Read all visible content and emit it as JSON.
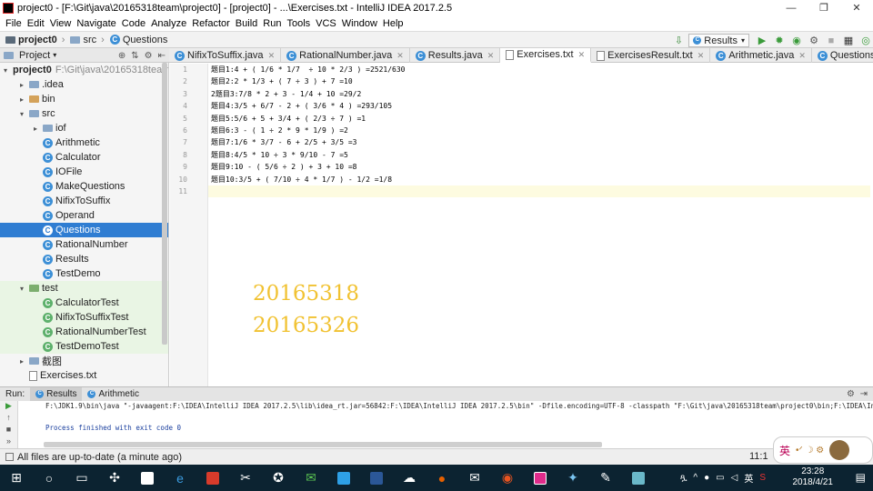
{
  "window": {
    "title": "project0 - [F:\\Git\\java\\20165318team\\project0] - [project0] - ...\\Exercises.txt - IntelliJ IDEA 2017.2.5",
    "controls": [
      "—",
      "❐",
      "✕"
    ]
  },
  "menu": [
    "File",
    "Edit",
    "View",
    "Navigate",
    "Code",
    "Analyze",
    "Refactor",
    "Build",
    "Run",
    "Tools",
    "VCS",
    "Window",
    "Help"
  ],
  "breadcrumb": [
    "project0",
    "src",
    "Questions"
  ],
  "toolbar": {
    "run_config": "Results"
  },
  "project_panel": {
    "title": "Project"
  },
  "tabs": [
    {
      "label": "NifixToSuffix.java",
      "kind": "class"
    },
    {
      "label": "RationalNumber.java",
      "kind": "class"
    },
    {
      "label": "Results.java",
      "kind": "class"
    },
    {
      "label": "Exercises.txt",
      "kind": "text",
      "active": true
    },
    {
      "label": "ExercisesResult.txt",
      "kind": "text"
    },
    {
      "label": "Arithmetic.java",
      "kind": "class"
    },
    {
      "label": "Questions.java",
      "kind": "class"
    }
  ],
  "tree": [
    {
      "label": "project0",
      "path": "F:\\Git\\java\\20165318team",
      "depth": 0,
      "arrow": "▾",
      "icon": "folder-dark",
      "bold": true
    },
    {
      "label": ".idea",
      "depth": 1,
      "arrow": "▸",
      "icon": "folder"
    },
    {
      "label": "bin",
      "depth": 1,
      "arrow": "▸",
      "icon": "folder-orange"
    },
    {
      "label": "src",
      "depth": 1,
      "arrow": "▾",
      "icon": "folder"
    },
    {
      "label": "iof",
      "depth": 2,
      "arrow": "▸",
      "icon": "folder"
    },
    {
      "label": "Arithmetic",
      "depth": 2,
      "icon": "class"
    },
    {
      "label": "Calculator",
      "depth": 2,
      "icon": "class"
    },
    {
      "label": "IOFile",
      "depth": 2,
      "icon": "class"
    },
    {
      "label": "MakeQuestions",
      "depth": 2,
      "icon": "class"
    },
    {
      "label": "NifixToSuffix",
      "depth": 2,
      "icon": "class"
    },
    {
      "label": "Operand",
      "depth": 2,
      "icon": "class"
    },
    {
      "label": "Questions",
      "depth": 2,
      "icon": "class",
      "selected": true
    },
    {
      "label": "RationalNumber",
      "depth": 2,
      "icon": "class"
    },
    {
      "label": "Results",
      "depth": 2,
      "icon": "class"
    },
    {
      "label": "TestDemo",
      "depth": 2,
      "icon": "class"
    },
    {
      "label": "test",
      "depth": 1,
      "arrow": "▾",
      "icon": "folder-green",
      "test": true
    },
    {
      "label": "CalculatorTest",
      "depth": 2,
      "icon": "class-green",
      "test": true
    },
    {
      "label": "NifixToSuffixTest",
      "depth": 2,
      "icon": "class-green",
      "test": true
    },
    {
      "label": "RationalNumberTest",
      "depth": 2,
      "icon": "class-green",
      "test": true
    },
    {
      "label": "TestDemoTest",
      "depth": 2,
      "icon": "class-green",
      "test": true
    },
    {
      "label": "截图",
      "depth": 1,
      "arrow": "▸",
      "icon": "folder"
    },
    {
      "label": "Exercises.txt",
      "depth": 1,
      "icon": "text"
    }
  ],
  "editor": {
    "lines": [
      "题目1:4 + ( 1/6 * 1/7  ÷ 10 * 2/3 ) =2521/630",
      "题目2:2 * 1/3 + ( 7 ÷ 3 ) + 7 =10",
      "2题目3:7/8 * 2 + 3 - 1/4 + 10 =29/2",
      "题目4:3/5 + 6/7 - 2 + ( 3/6 * 4 ) =293/105",
      "题目5:5/6 + 5 + 3/4 + ( 2/3 ÷ 7 ) =1",
      "题目6:3 - ( 1 ÷ 2 * 9 * 1/9 ) =2",
      "题目7:1/6 * 3/7 - 6 + 2/5 + 3/5 =3",
      "题目8:4/5 * 10 ÷ 3 * 9/10 - 7 =5",
      "题目9:10 - ( 5/6 ÷ 2 ) + 3 + 10 =8",
      "题目10:3/5 + ( 7/10 ÷ 4 * 1/7 ) - 1/2 =1/8",
      ""
    ],
    "overlay": [
      "20165318",
      "20165326"
    ]
  },
  "run": {
    "label": "Run:",
    "tabs": [
      "Results",
      "Arithmetic"
    ],
    "command": "F:\\JDK1.9\\bin\\java \"-javaagent:F:\\IDEA\\IntelliJ IDEA 2017.2.5\\lib\\idea_rt.jar=56842:F:\\IDEA\\IntelliJ IDEA 2017.2.5\\bin\" -Dfile.encoding=UTF-8 -classpath \"F:\\Git\\java\\20165318team\\project0\\bin;F:\\IDEA\\In",
    "exit": "Process finished with exit code 0"
  },
  "status": {
    "message": "All files are up-to-date (a minute ago)",
    "position": "11:1"
  },
  "ime": {
    "label": "英"
  },
  "clock": {
    "time": "23:28",
    "date": "2018/4/21"
  },
  "tray": {
    "lang": "英"
  }
}
